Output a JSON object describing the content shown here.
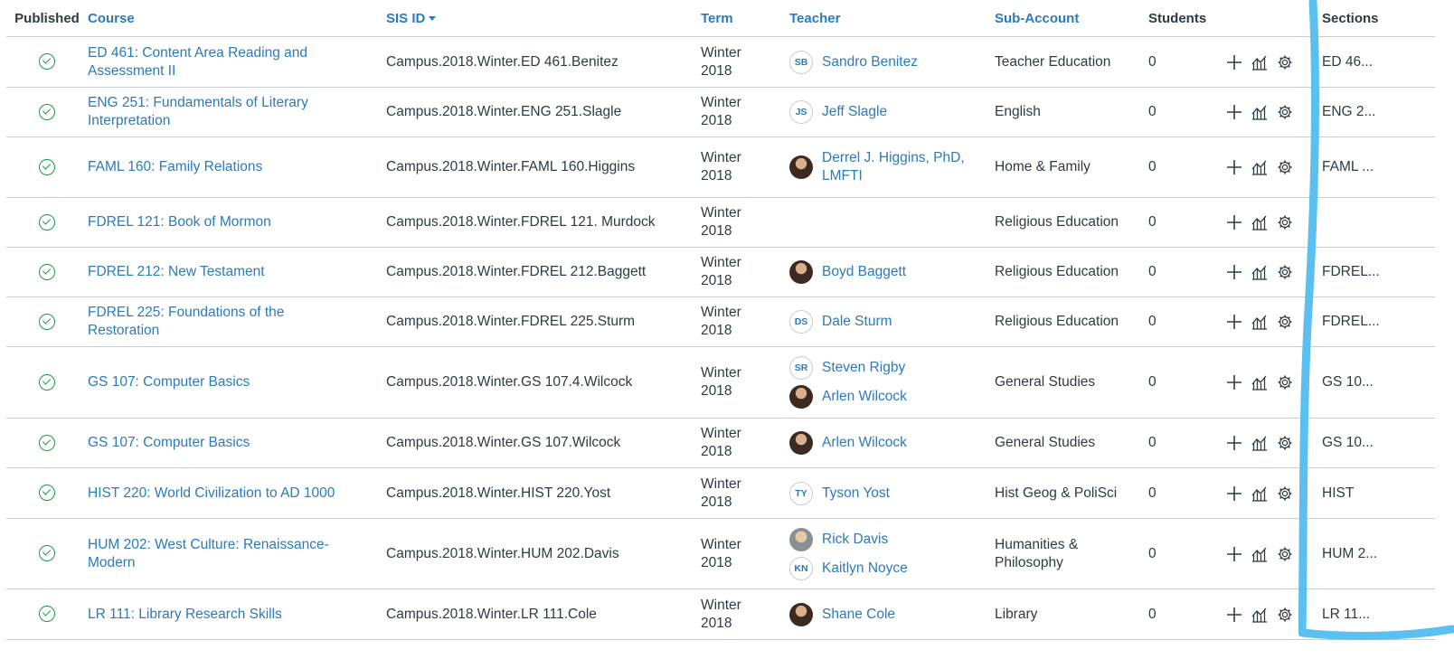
{
  "headers": {
    "published": "Published",
    "course": "Course",
    "sis_id": "SIS ID",
    "term": "Term",
    "teacher": "Teacher",
    "sub_account": "Sub-Account",
    "students": "Students",
    "sections": "Sections"
  },
  "rows": [
    {
      "course": "ED 461: Content Area Reading and Assessment II",
      "sis": "Campus.2018.Winter.ED 461.Benitez",
      "term": "Winter 2018",
      "teachers": [
        {
          "initials": "SB",
          "name": "Sandro Benitez",
          "avatar": "initials"
        }
      ],
      "sub": "Teacher Education",
      "students": "0",
      "sections": "ED 46..."
    },
    {
      "course": "ENG 251: Fundamentals of Literary Interpretation",
      "sis": "Campus.2018.Winter.ENG 251.Slagle",
      "term": "Winter 2018",
      "teachers": [
        {
          "initials": "JS",
          "name": "Jeff Slagle",
          "avatar": "initials"
        }
      ],
      "sub": "English",
      "students": "0",
      "sections": "ENG 2..."
    },
    {
      "course": "FAML 160: Family Relations",
      "sis": "Campus.2018.Winter.FAML 160.Higgins",
      "term": "Winter 2018",
      "teachers": [
        {
          "initials": "",
          "name": "Derrel J. Higgins, PhD, LMFTI",
          "avatar": "photo"
        }
      ],
      "sub": "Home & Family",
      "students": "0",
      "sections": "FAML ..."
    },
    {
      "course": "FDREL 121: Book of Mormon",
      "sis": "Campus.2018.Winter.FDREL 121. Murdock",
      "term": "Winter 2018",
      "teachers": [],
      "sub": "Religious Education",
      "students": "0",
      "sections": ""
    },
    {
      "course": "FDREL 212: New Testament",
      "sis": "Campus.2018.Winter.FDREL 212.Baggett",
      "term": "Winter 2018",
      "teachers": [
        {
          "initials": "",
          "name": "Boyd Baggett",
          "avatar": "photo"
        }
      ],
      "sub": "Religious Education",
      "students": "0",
      "sections": "FDREL..."
    },
    {
      "course": "FDREL 225: Foundations of the Restoration",
      "sis": "Campus.2018.Winter.FDREL 225.Sturm",
      "term": "Winter 2018",
      "teachers": [
        {
          "initials": "DS",
          "name": "Dale Sturm",
          "avatar": "initials"
        }
      ],
      "sub": "Religious Education",
      "students": "0",
      "sections": "FDREL..."
    },
    {
      "course": "GS 107: Computer Basics",
      "sis": "Campus.2018.Winter.GS 107.4.Wilcock",
      "term": "Winter 2018",
      "teachers": [
        {
          "initials": "SR",
          "name": "Steven Rigby",
          "avatar": "initials"
        },
        {
          "initials": "",
          "name": "Arlen Wilcock",
          "avatar": "photo"
        }
      ],
      "sub": "General Studies",
      "students": "0",
      "sections": "GS 10..."
    },
    {
      "course": "GS 107: Computer Basics",
      "sis": "Campus.2018.Winter.GS 107.Wilcock",
      "term": "Winter 2018",
      "teachers": [
        {
          "initials": "",
          "name": "Arlen Wilcock",
          "avatar": "photo"
        }
      ],
      "sub": "General Studies",
      "students": "0",
      "sections": "GS 10..."
    },
    {
      "course": "HIST 220: World Civilization to AD 1000",
      "sis": "Campus.2018.Winter.HIST 220.Yost",
      "term": "Winter 2018",
      "teachers": [
        {
          "initials": "TY",
          "name": "Tyson Yost",
          "avatar": "initials"
        }
      ],
      "sub": "Hist Geog & PoliSci",
      "students": "0",
      "sections": "HIST"
    },
    {
      "course": "HUM 202: West Culture: Renaissance-Modern",
      "sis": "Campus.2018.Winter.HUM 202.Davis",
      "term": "Winter 2018",
      "teachers": [
        {
          "initials": "",
          "name": "Rick Davis",
          "avatar": "photo2"
        },
        {
          "initials": "KN",
          "name": "Kaitlyn Noyce",
          "avatar": "initials"
        }
      ],
      "sub": "Humanities & Philosophy",
      "students": "0",
      "sections": "HUM 2..."
    },
    {
      "course": "LR 111: Library Research Skills",
      "sis": "Campus.2018.Winter.LR 111.Cole",
      "term": "Winter 2018",
      "teachers": [
        {
          "initials": "",
          "name": "Shane Cole",
          "avatar": "photo"
        }
      ],
      "sub": "Library",
      "students": "0",
      "sections": "LR 11..."
    }
  ],
  "colors": {
    "link": "#2b7abc",
    "text": "#2d3b45",
    "published": "#1a9a46",
    "annotation": "#5bc0f0"
  }
}
